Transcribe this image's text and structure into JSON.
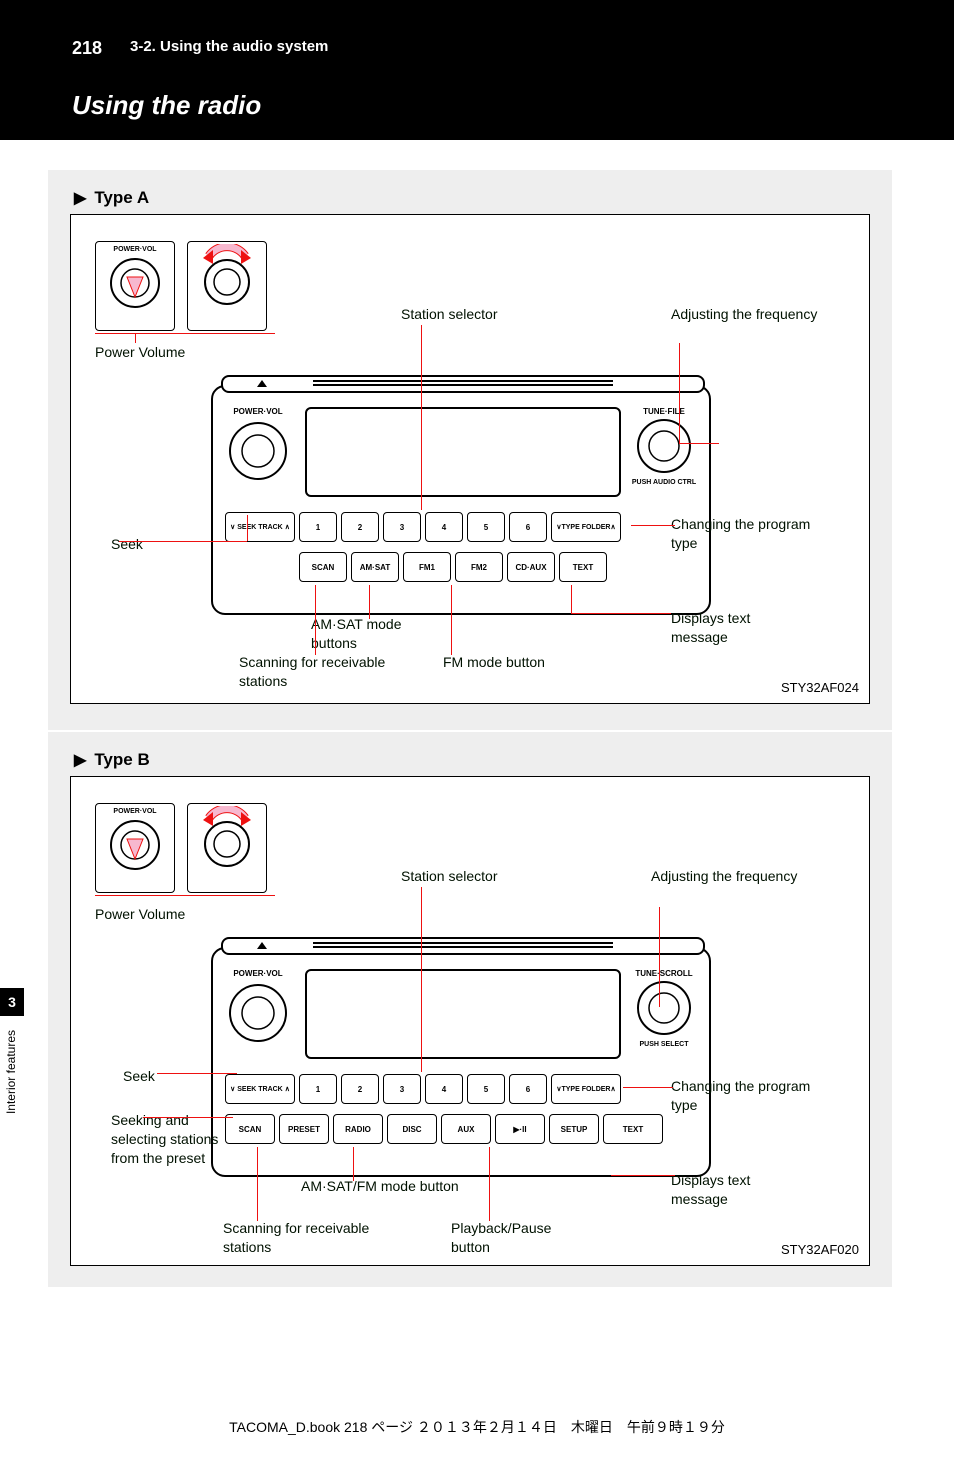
{
  "header": {
    "page_number": "218",
    "breadcrumb": "3-2. Using the audio system",
    "title": "Using the radio"
  },
  "side": {
    "chapter": "3",
    "label": "Interior features"
  },
  "panel_a": {
    "section_label": "Type A",
    "image_id": "STY32AF024",
    "vignette_label": "POWER·VOL",
    "unit": {
      "left_knob": "POWER·VOL",
      "right_knob_top": "TUNE·FILE",
      "right_knob_bottom": "PUSH AUDIO CTRL",
      "seek_label": "SEEK\nTRACK",
      "nums": [
        "1",
        "2",
        "3",
        "4",
        "5",
        "6"
      ],
      "type_folder": "TYPE\nFOLDER",
      "row2": [
        "SCAN",
        "AM·SAT",
        "FM1",
        "FM2",
        "CD·AUX",
        "TEXT"
      ]
    },
    "callouts": {
      "power": "Power Volume",
      "preset": "Station selector",
      "adjust": "Adjusting the frequency",
      "seek": "Seek",
      "scan": "Scanning for receivable stations",
      "am_mode": "AM·SAT mode buttons",
      "fm_mode": "FM mode button",
      "text": "Displays text message",
      "type": "Changing the program type"
    }
  },
  "panel_b": {
    "section_label": "Type B",
    "image_id": "STY32AF020",
    "vignette_label": "POWER·VOL",
    "unit": {
      "left_knob": "POWER·VOL",
      "right_knob_top": "TUNE·SCROLL",
      "right_knob_bottom": "PUSH SELECT",
      "seek_label": "SEEK\nTRACK",
      "nums": [
        "1",
        "2",
        "3",
        "4",
        "5",
        "6"
      ],
      "type_folder": "TYPE\nFOLDER",
      "row2": [
        "SCAN",
        "PRESET",
        "RADIO",
        "DISC",
        "AUX",
        "▶·II",
        "SETUP",
        "TEXT"
      ]
    },
    "callouts": {
      "power": "Power Volume",
      "preset": "Station selector",
      "adjust": "Adjusting the frequency",
      "seek": "Seek",
      "up_down": "Seeking and selecting stations from the preset",
      "scan": "Scanning for receivable stations",
      "radio_mode": "AM·SAT/FM mode button",
      "text": "Displays text message",
      "type": "Changing the program type",
      "playback": "Playback/Pause button"
    }
  },
  "footer": "TACOMA_D.book  218 ページ  ２０１３年２月１４日　木曜日　午前９時１９分"
}
